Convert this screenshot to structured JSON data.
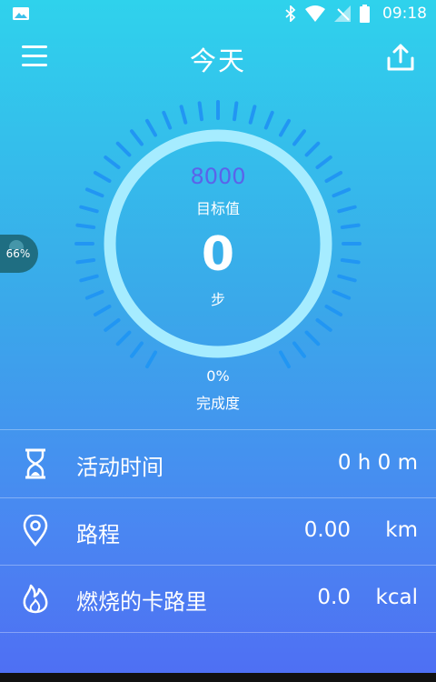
{
  "status": {
    "time": "09:18"
  },
  "header": {
    "title": "今天"
  },
  "badge": {
    "text": "66%"
  },
  "gauge": {
    "target_value": "8000",
    "target_label": "目标值",
    "steps": "0",
    "steps_unit": "步",
    "completion": "0%",
    "completion_label": "完成度"
  },
  "metrics": [
    {
      "icon": "hourglass-icon",
      "label": "活动时间",
      "value": "0 h 0 m",
      "unit": ""
    },
    {
      "icon": "location-pin-icon",
      "label": "路程",
      "value": "0.00",
      "unit": "km"
    },
    {
      "icon": "flame-icon",
      "label": "燃烧的卡路里",
      "value": "0.0",
      "unit": "kcal"
    }
  ],
  "colors": {
    "accent": "#5b63ea",
    "ring": "#a6ecff",
    "tick": "#2196f3",
    "badge": "#1f6e82"
  }
}
